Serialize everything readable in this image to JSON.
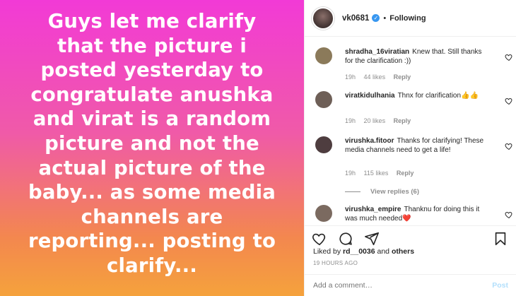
{
  "post": {
    "text_lines": [
      "Guys let me clarify",
      "that the picture i",
      "posted yesterday to",
      "congratulate anushka",
      "and virat is a random",
      "picture and not the",
      "actual picture of the",
      "baby... as some media",
      "channels are",
      "reporting... posting to",
      "clarify..."
    ]
  },
  "header": {
    "username": "vk0681",
    "verified_glyph": "✓",
    "separator": "•",
    "follow_status": "Following"
  },
  "comments": [
    {
      "username": "shradha_16viratian",
      "text": "Knew that. Still thanks for the clarification :))",
      "time": "19h",
      "likes": "44 likes",
      "reply": "Reply",
      "avatar_color": "#8b7a5a"
    },
    {
      "username": "viratkidulhania",
      "text": "Thnx for clarification👍👍",
      "time": "19h",
      "likes": "20 likes",
      "reply": "Reply",
      "avatar_color": "#6e5f57"
    },
    {
      "username": "virushka.fitoor",
      "text": "Thanks for clarifying! These media channels need to get a life!",
      "time": "19h",
      "likes": "115 likes",
      "reply": "Reply",
      "avatar_color": "#4e3d3f"
    },
    {
      "username": "virushka_empire",
      "text": "Thanknu for doing this it was much needed❤️",
      "avatar_color": "#7b6a60"
    }
  ],
  "view_replies": "View replies (6)",
  "likes": {
    "prefix": "Liked by",
    "user": "rd__0036",
    "middle": "and",
    "others": "others"
  },
  "post_time": "19 HOURS AGO",
  "add_comment": {
    "placeholder": "Add a comment…",
    "post_label": "Post"
  },
  "icons": [
    "verified-icon",
    "heart-icon",
    "comment-icon",
    "share-icon",
    "bookmark-icon"
  ],
  "colors": {
    "accent_blue": "#3897f0",
    "post_button_disabled": "#b2dffc",
    "muted_text": "#8e8e8e"
  }
}
